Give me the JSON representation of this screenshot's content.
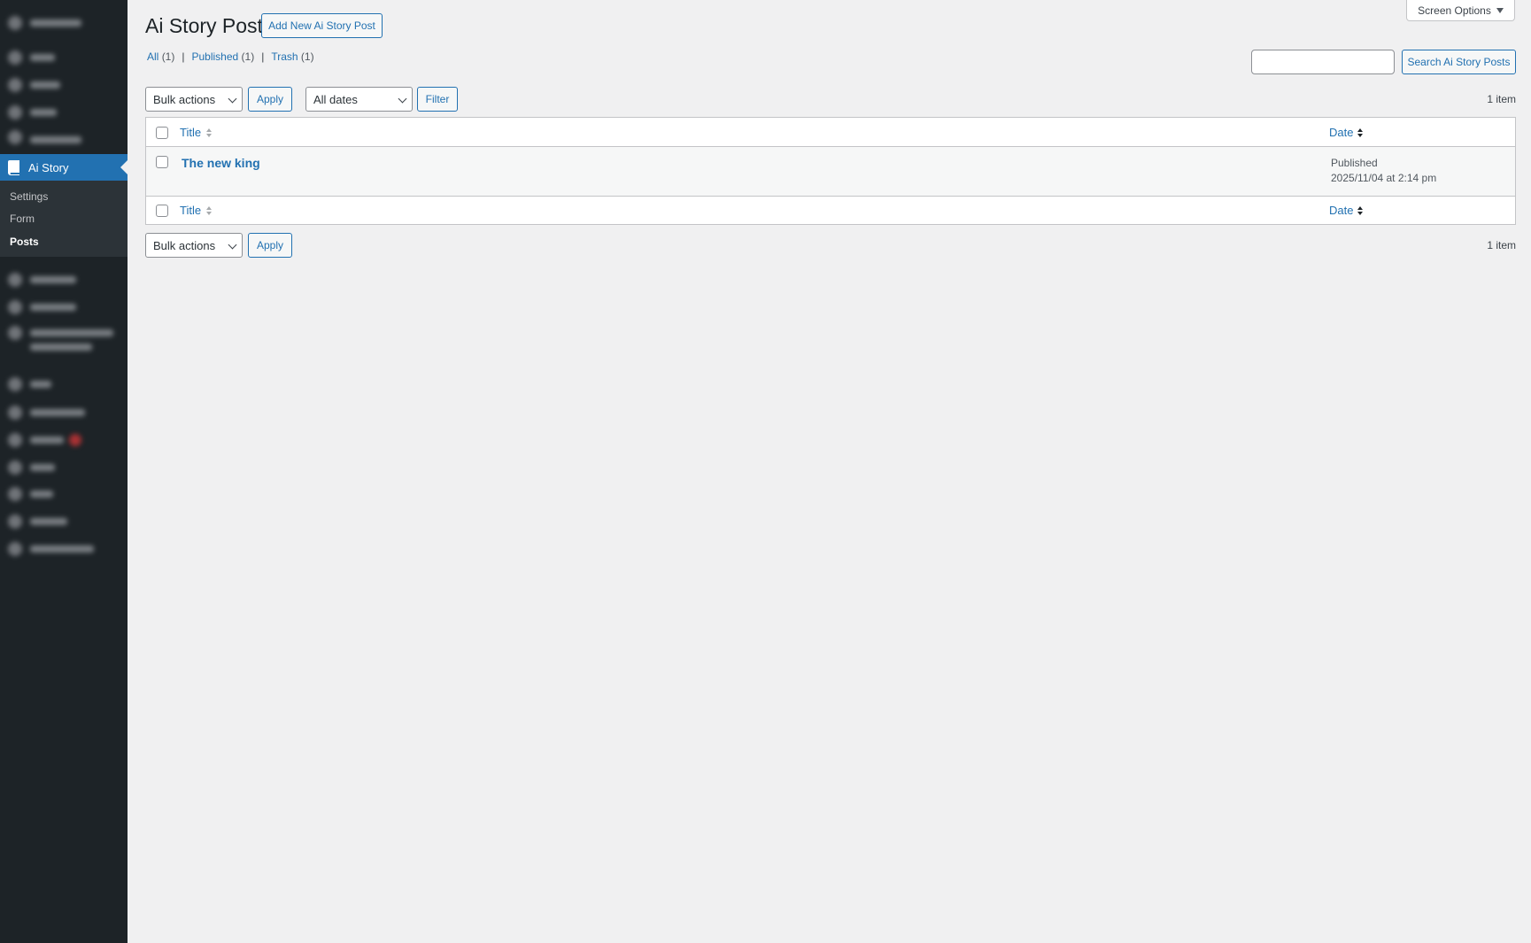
{
  "sidebar": {
    "active_menu": {
      "label": "Ai Story",
      "icon": "book-icon"
    },
    "submenu": [
      {
        "label": "Settings"
      },
      {
        "label": "Form"
      },
      {
        "label": "Posts"
      }
    ]
  },
  "header": {
    "title": "Ai Story Posts",
    "add_new_label": "Add New Ai Story Post",
    "screen_options_label": "Screen Options"
  },
  "views": [
    {
      "label": "All",
      "count": "(1)"
    },
    {
      "label": "Published",
      "count": "(1)"
    },
    {
      "label": "Trash",
      "count": "(1)"
    }
  ],
  "search": {
    "button_label": "Search Ai Story Posts",
    "value": ""
  },
  "tablenav_top": {
    "bulk_actions": "Bulk actions",
    "apply_label": "Apply",
    "dates_filter": "All dates",
    "filter_label": "Filter",
    "items_count": "1 item"
  },
  "table": {
    "columns": {
      "title": "Title",
      "date": "Date"
    },
    "rows": [
      {
        "title": "The new king",
        "status": "Published",
        "date": "2025/11/04 at 2:14 pm"
      }
    ]
  },
  "tablenav_bottom": {
    "bulk_actions": "Bulk actions",
    "apply_label": "Apply",
    "items_count": "1 item"
  },
  "colors": {
    "sidebar_bg": "#1d2327",
    "accent": "#2271b1",
    "page_bg": "#f0f0f1"
  }
}
